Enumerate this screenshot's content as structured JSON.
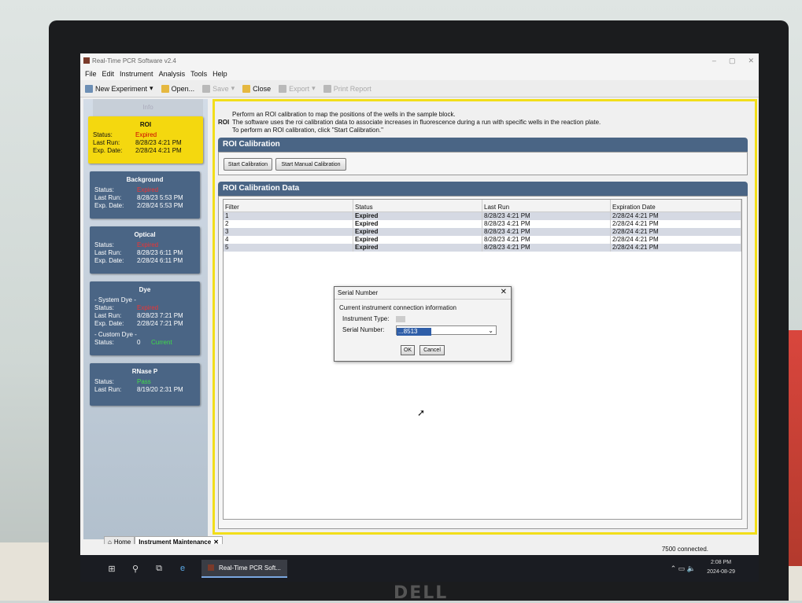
{
  "app": {
    "title": "Real-Time PCR Software v2.4",
    "window_controls": [
      "–",
      "▢",
      "✕"
    ]
  },
  "menu": [
    "File",
    "Edit",
    "Instrument",
    "Analysis",
    "Tools",
    "Help"
  ],
  "toolbar": {
    "new_experiment": "New Experiment",
    "open": "Open...",
    "save": "Save",
    "close": "Close",
    "export": "Export",
    "print_report": "Print Report"
  },
  "left_panel": {
    "dim_tab": "Info",
    "roi": {
      "title": "ROI",
      "status_k": "Status:",
      "status": "Expired",
      "last_run_k": "Last Run:",
      "last_run": "8/28/23 4:21 PM",
      "exp_k": "Exp. Date:",
      "exp": "2/28/24 4:21 PM"
    },
    "background": {
      "title": "Background",
      "status_k": "Status:",
      "status": "Expired",
      "last_run_k": "Last Run:",
      "last_run": "8/28/23 5:53 PM",
      "exp_k": "Exp. Date:",
      "exp": "2/28/24 5:53 PM"
    },
    "optical": {
      "title": "Optical",
      "status_k": "Status:",
      "status": "Expired",
      "last_run_k": "Last Run:",
      "last_run": "8/28/23 6:11 PM",
      "exp_k": "Exp. Date:",
      "exp": "2/28/24 6:11 PM"
    },
    "dye": {
      "title": "Dye",
      "system_label": "- System Dye -",
      "status_k": "Status:",
      "status": "Expired",
      "last_run_k": "Last Run:",
      "last_run": "8/28/23 7:21 PM",
      "exp_k": "Exp. Date:",
      "exp": "2/28/24 7:21 PM",
      "custom_label": "- Custom Dye -",
      "custom_status_k": "Status:",
      "custom_count": "0",
      "custom_status": "Current"
    },
    "rnase": {
      "title": "RNase P",
      "status_k": "Status:",
      "status": "Pass",
      "last_run_k": "Last Run:",
      "last_run": "8/19/20 2:31 PM"
    }
  },
  "main": {
    "info_label": "ROI",
    "info_lines": [
      "Perform an ROI calibration to map the positions of the wells in the sample block.",
      "The software uses the roi calibration data to associate increases in fluorescence during a run with specific wells in the reaction plate.",
      "To perform an ROI calibration, click \"Start Calibration.\""
    ],
    "calib_header": "ROI Calibration",
    "start_calibration": "Start Calibration",
    "start_manual_calibration": "Start Manual Calibration",
    "data_header": "ROI Calibration Data",
    "columns": [
      "Filter",
      "Status",
      "Last Run",
      "Expiration Date"
    ],
    "rows": [
      [
        "1",
        "Expired",
        "8/28/23 4:21 PM",
        "2/28/24 4:21 PM"
      ],
      [
        "2",
        "Expired",
        "8/28/23 4:21 PM",
        "2/28/24 4:21 PM"
      ],
      [
        "3",
        "Expired",
        "8/28/23 4:21 PM",
        "2/28/24 4:21 PM"
      ],
      [
        "4",
        "Expired",
        "8/28/23 4:21 PM",
        "2/28/24 4:21 PM"
      ],
      [
        "5",
        "Expired",
        "8/28/23 4:21 PM",
        "2/28/24 4:21 PM"
      ]
    ]
  },
  "dialog": {
    "title": "Serial Number",
    "message": "Current instrument connection information",
    "instrument_type_label": "Instrument Type:",
    "serial_label": "Serial Number:",
    "serial_value": "...8513",
    "ok": "OK",
    "cancel": "Cancel"
  },
  "tabs": {
    "home": "Home",
    "maintenance": "Instrument Maintenance"
  },
  "status_bar": {
    "connection": "7500  connected."
  },
  "taskbar": {
    "app": "Real-Time PCR Soft...",
    "time": "2:08 PM",
    "date": "2024-08-29"
  },
  "monitor_brand": "DELL"
}
